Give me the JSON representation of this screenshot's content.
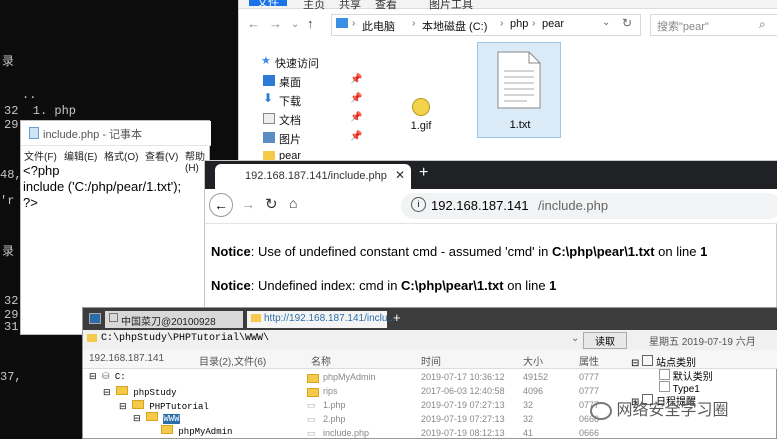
{
  "console": {
    "lines": [
      "录",
      "..",
      "32  1. php",
      "29",
      "48,",
      "'r",
      "录",
      "32",
      "29",
      "31",
      "37, "
    ]
  },
  "explorer": {
    "tabs": [
      "文件",
      "主页",
      "共享",
      "查看",
      "图片工具"
    ],
    "breadcrumb": [
      "此电脑",
      "本地磁盘 (C:)",
      "php",
      "pear"
    ],
    "search_placeholder": "搜索\"pear\"",
    "sidebar": [
      {
        "label": "快速访问",
        "icon": "star-icon"
      },
      {
        "label": "桌面",
        "icon": "desktop-icon",
        "pinned": true
      },
      {
        "label": "下载",
        "icon": "download-icon",
        "pinned": true
      },
      {
        "label": "文档",
        "icon": "document-icon",
        "pinned": true
      },
      {
        "label": "图片",
        "icon": "picture-icon",
        "pinned": true
      },
      {
        "label": "pear",
        "icon": "folder-icon"
      }
    ],
    "files": [
      {
        "name": "1.gif",
        "icon": "gif-icon"
      },
      {
        "name": "1.txt",
        "icon": "text-file-icon"
      }
    ]
  },
  "notepad": {
    "title": "include.php - 记事本",
    "menu": [
      "文件(F)",
      "编辑(E)",
      "格式(O)",
      "查看(V)",
      "帮助(H)"
    ],
    "content": "<?php\ninclude ('C:/php/pear/1.txt');\n?>"
  },
  "browser": {
    "tab_title": "192.168.187.141/include.php",
    "url_host": "192.168.187.141",
    "url_path": "/include.php",
    "notices": [
      {
        "label": "Notice",
        "text_before": ": Use of undefined constant cmd - assumed 'cmd' in ",
        "path": "C:\\php\\pear\\1.txt",
        "text_mid": " on line ",
        "line": "1"
      },
      {
        "label": "Notice",
        "text_before": ": Undefined index: cmd in ",
        "path": "C:\\php\\pear\\1.txt",
        "text_mid": " on line ",
        "line": "1"
      }
    ]
  },
  "filemanager": {
    "tabs": [
      "中国菜刀@20100928",
      "http://192.168.187.141/inclu..."
    ],
    "path": "C:\\phpStudy\\PHPTutorial\\WWW\\",
    "read_button": "读取",
    "date_text": "星期五 2019-07-19 六月",
    "ip": "192.168.187.141",
    "header": {
      "dirs": "目录(2),文件(6)",
      "name": "名称",
      "time": "时间",
      "size": "大小",
      "attr": "属性"
    },
    "tree": [
      "C:",
      "phpStudy",
      "PHPTutorial",
      "WWW",
      "phpMyAdmin"
    ],
    "rows": [
      {
        "name": "phpMyAdmin",
        "time": "2019-07-17 10:36:12",
        "size": "49152",
        "attr": "0777",
        "folder": true
      },
      {
        "name": "rips",
        "time": "2017-06-03 12:40:58",
        "size": "4096",
        "attr": "0777",
        "folder": true
      },
      {
        "name": "1.php",
        "time": "2019-07-19 07:27:13",
        "size": "32",
        "attr": "0777"
      },
      {
        "name": "2.php",
        "time": "2019-07-19 07:27:13",
        "size": "32",
        "attr": "0666"
      },
      {
        "name": "include.php",
        "time": "2019-07-19 08:12:13",
        "size": "41",
        "attr": "0666"
      }
    ],
    "right_tree": [
      "站点类别",
      "默认类别",
      "Type1",
      "日程提醒"
    ]
  },
  "watermark": "网络安全学习圈"
}
